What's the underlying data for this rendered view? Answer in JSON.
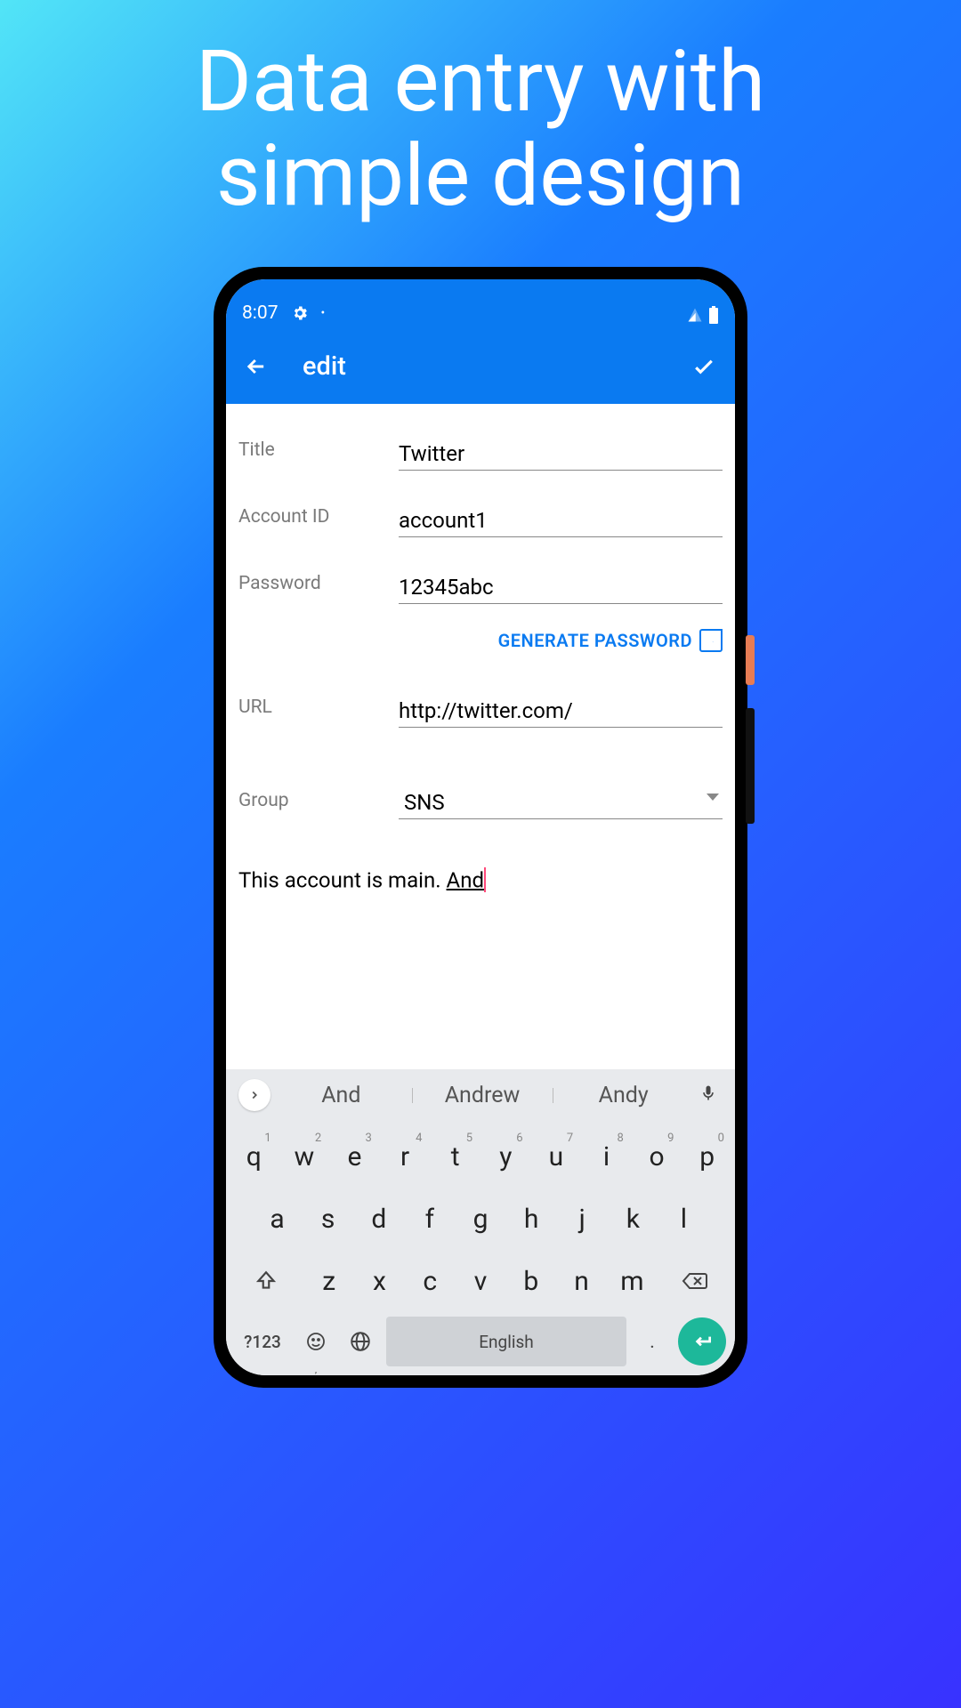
{
  "promo": {
    "heading_line1": "Data entry with",
    "heading_line2": "simple design"
  },
  "status": {
    "time": "8:07"
  },
  "appbar": {
    "title": "edit"
  },
  "form": {
    "title": {
      "label": "Title",
      "value": "Twitter"
    },
    "account_id": {
      "label": "Account ID",
      "value": "account1"
    },
    "password": {
      "label": "Password",
      "value": "12345abc"
    },
    "generate_label": "GENERATE PASSWORD",
    "url": {
      "label": "URL",
      "value": "http://twitter.com/"
    },
    "group": {
      "label": "Group",
      "value": "SNS"
    },
    "notes": {
      "text": "This account is main. ",
      "partial": "And"
    }
  },
  "keyboard": {
    "suggestions": [
      "And",
      "Andrew",
      "Andy"
    ],
    "row1": [
      {
        "k": "q",
        "n": "1"
      },
      {
        "k": "w",
        "n": "2"
      },
      {
        "k": "e",
        "n": "3"
      },
      {
        "k": "r",
        "n": "4"
      },
      {
        "k": "t",
        "n": "5"
      },
      {
        "k": "y",
        "n": "6"
      },
      {
        "k": "u",
        "n": "7"
      },
      {
        "k": "i",
        "n": "8"
      },
      {
        "k": "o",
        "n": "9"
      },
      {
        "k": "p",
        "n": "0"
      }
    ],
    "row2": [
      "a",
      "s",
      "d",
      "f",
      "g",
      "h",
      "j",
      "k",
      "l"
    ],
    "row3": [
      "z",
      "x",
      "c",
      "v",
      "b",
      "n",
      "m"
    ],
    "bottom": {
      "sym": "?123",
      "space": "English",
      "dot": "."
    }
  }
}
